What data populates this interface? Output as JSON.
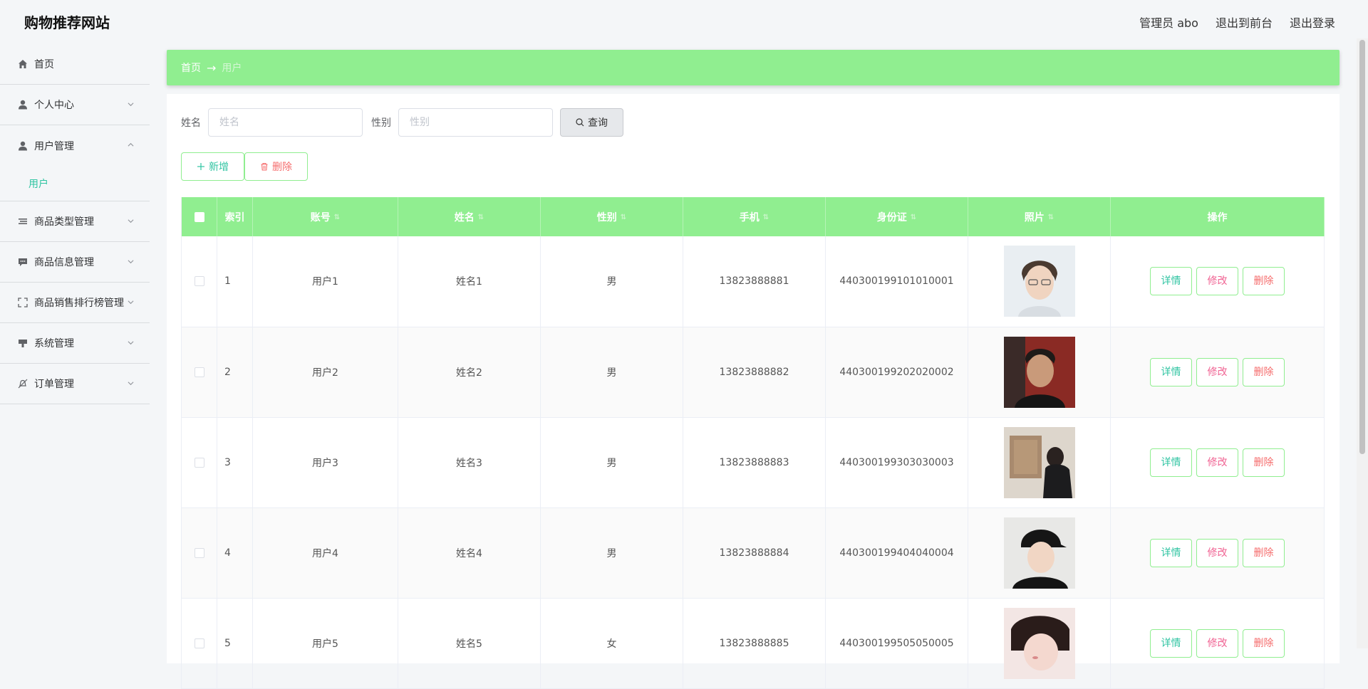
{
  "header": {
    "site_title": "购物推荐网站",
    "user_label": "管理员 abo",
    "front_link": "退出到前台",
    "logout_link": "退出登录"
  },
  "sidebar": {
    "items": [
      {
        "label": "首页",
        "icon": "home-icon"
      },
      {
        "label": "个人中心",
        "icon": "user-icon"
      },
      {
        "label": "用户管理",
        "icon": "user-icon",
        "expanded": true,
        "subitems": [
          {
            "label": "用户"
          }
        ]
      },
      {
        "label": "商品类型管理",
        "icon": "list-icon"
      },
      {
        "label": "商品信息管理",
        "icon": "chat-icon"
      },
      {
        "label": "商品销售排行榜管理",
        "icon": "fullscreen-icon"
      },
      {
        "label": "系统管理",
        "icon": "stamp-icon"
      },
      {
        "label": "订单管理",
        "icon": "bell-off-icon"
      }
    ]
  },
  "breadcrumb": {
    "home": "首页",
    "separator": "→",
    "current": "用户"
  },
  "search": {
    "name_label": "姓名",
    "name_placeholder": "姓名",
    "gender_label": "性别",
    "gender_placeholder": "性别",
    "query_button": "查询"
  },
  "actions": {
    "add_button": "新增",
    "delete_button": "删除"
  },
  "table": {
    "headers": {
      "index": "索引",
      "account": "账号",
      "name": "姓名",
      "gender": "性别",
      "phone": "手机",
      "id_card": "身份证",
      "photo": "照片",
      "ops": "操作"
    },
    "op_labels": {
      "detail": "详情",
      "edit": "修改",
      "delete": "删除"
    },
    "rows": [
      {
        "index": "1",
        "account": "用户1",
        "name": "姓名1",
        "gender": "男",
        "phone": "13823888881",
        "id_card": "440300199101010001"
      },
      {
        "index": "2",
        "account": "用户2",
        "name": "姓名2",
        "gender": "男",
        "phone": "13823888882",
        "id_card": "440300199202020002"
      },
      {
        "index": "3",
        "account": "用户3",
        "name": "姓名3",
        "gender": "男",
        "phone": "13823888883",
        "id_card": "440300199303030003"
      },
      {
        "index": "4",
        "account": "用户4",
        "name": "姓名4",
        "gender": "男",
        "phone": "13823888884",
        "id_card": "440300199404040004"
      },
      {
        "index": "5",
        "account": "用户5",
        "name": "姓名5",
        "gender": "女",
        "phone": "13823888885",
        "id_card": "440300199505050005"
      }
    ]
  },
  "colors": {
    "accent_green": "#90ee90",
    "teal_text": "#2fc4a2",
    "danger": "#f56c6c",
    "edit_pink": "#f06292"
  }
}
